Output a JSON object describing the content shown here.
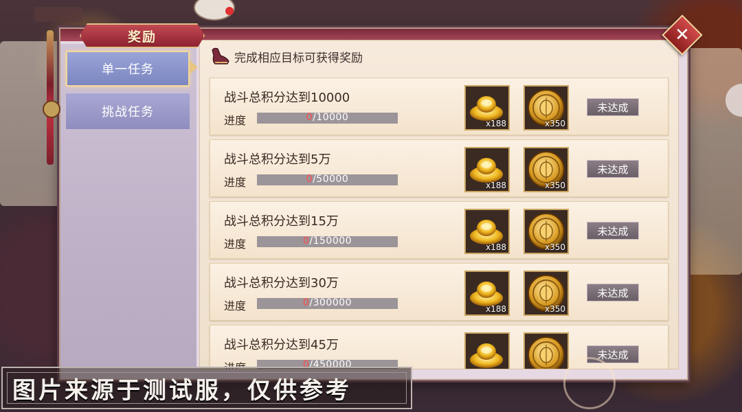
{
  "title": "奖励",
  "close_label": "✕",
  "sidebar": {
    "tabs": [
      {
        "label": "单一任务",
        "active": true
      },
      {
        "label": "挑战任务",
        "active": false
      }
    ]
  },
  "content": {
    "header_text": "完成相应目标可获得奖励",
    "progress_label": "进度",
    "tasks": [
      {
        "title": "战斗总积分达到10000",
        "progress_current": "0",
        "progress_total": "/10000",
        "progress_fraction": 0,
        "rewards": [
          {
            "icon": "gold-ingot-icon",
            "qty": "x188"
          },
          {
            "icon": "lantern-coin-icon",
            "qty": "x350"
          }
        ],
        "status": "未达成"
      },
      {
        "title": "战斗总积分达到5万",
        "progress_current": "0",
        "progress_total": "/50000",
        "progress_fraction": 0,
        "rewards": [
          {
            "icon": "gold-ingot-icon",
            "qty": "x188"
          },
          {
            "icon": "lantern-coin-icon",
            "qty": "x350"
          }
        ],
        "status": "未达成"
      },
      {
        "title": "战斗总积分达到15万",
        "progress_current": "0",
        "progress_total": "/150000",
        "progress_fraction": 0,
        "rewards": [
          {
            "icon": "gold-ingot-icon",
            "qty": "x188"
          },
          {
            "icon": "lantern-coin-icon",
            "qty": "x350"
          }
        ],
        "status": "未达成"
      },
      {
        "title": "战斗总积分达到30万",
        "progress_current": "0",
        "progress_total": "/300000",
        "progress_fraction": 0,
        "rewards": [
          {
            "icon": "gold-ingot-icon",
            "qty": "x188"
          },
          {
            "icon": "lantern-coin-icon",
            "qty": "x350"
          }
        ],
        "status": "未达成"
      },
      {
        "title": "战斗总积分达到45万",
        "progress_current": "0",
        "progress_total": "/450000",
        "progress_fraction": 0,
        "rewards": [
          {
            "icon": "gold-ingot-icon",
            "qty": ""
          },
          {
            "icon": "lantern-coin-icon",
            "qty": ""
          }
        ],
        "status": "未达成"
      }
    ]
  },
  "watermark": "图片来源于测试服，仅供参考",
  "colors": {
    "accent_red": "#8e2230",
    "gold_border": "#c9a461",
    "progress_current": "#ff4c4c"
  }
}
